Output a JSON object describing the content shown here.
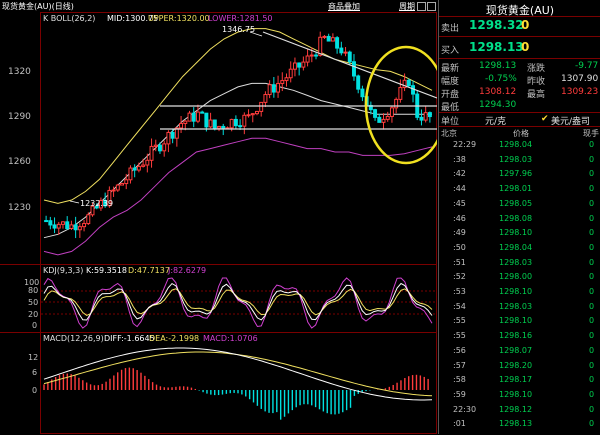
{
  "header": {
    "title": "现货黄金(AU)(日线)",
    "buttons": [
      "商品叠加",
      "周期"
    ],
    "extra_label": "周期"
  },
  "main_chart": {
    "label": "K  BOLL(26,2)",
    "mid": "MID:1300.75",
    "upper": "UPPER:1320.00",
    "lower": "LOWER:1281.50",
    "high_label": "1346.75",
    "low_label": "1232.39",
    "y_ticks": [
      "1320",
      "1290",
      "1260",
      "1230"
    ]
  },
  "kdj": {
    "label": "KDJ(9,3,3)",
    "k": "K:59.3518",
    "d": "D:47.7137",
    "j": "J:82.6279",
    "y_ticks": [
      "100",
      "80",
      "50",
      "20",
      "0"
    ]
  },
  "macd": {
    "label": "MACD(12,26,9)",
    "diff": "DIFF:-1.6645",
    "dea": "DEA:-2.1998",
    "macd": "MACD:1.0706",
    "y_ticks": [
      "12",
      "6",
      "0"
    ]
  },
  "quote": {
    "title": "现货黄金(AU)",
    "sell_label": "卖出",
    "sell_price": "1298.32",
    "sell_vol": "0",
    "buy_label": "买入",
    "buy_price": "1298.13",
    "buy_vol": "0",
    "rows": [
      {
        "l1": "最新",
        "v1": "1298.13",
        "l2": "涨跌",
        "v2": "-9.77"
      },
      {
        "l1": "幅度",
        "v1": "-0.75%",
        "l2": "昨收",
        "v2": "1307.90"
      },
      {
        "l1": "开盘",
        "v1": "1308.12",
        "l2": "最高",
        "v2": "1309.23"
      },
      {
        "l1": "最低",
        "v1": "1294.30",
        "l2": "",
        "v2": ""
      }
    ],
    "unit_label": "单位",
    "unit_value": "元/克",
    "currency": "美元/盎司",
    "col_time": "北京",
    "col_price": "价格",
    "col_vol": "现手"
  },
  "ticks": [
    {
      "t": "22:29",
      "p": "1298.04",
      "v": "0"
    },
    {
      "t": ":38",
      "p": "1298.03",
      "v": "0"
    },
    {
      "t": ":42",
      "p": "1297.96",
      "v": "0"
    },
    {
      "t": ":44",
      "p": "1298.01",
      "v": "0"
    },
    {
      "t": ":45",
      "p": "1298.05",
      "v": "0"
    },
    {
      "t": ":46",
      "p": "1298.08",
      "v": "0"
    },
    {
      "t": ":49",
      "p": "1298.10",
      "v": "0"
    },
    {
      "t": ":50",
      "p": "1298.04",
      "v": "0"
    },
    {
      "t": ":51",
      "p": "1298.03",
      "v": "0"
    },
    {
      "t": ":52",
      "p": "1298.00",
      "v": "0"
    },
    {
      "t": ":53",
      "p": "1298.10",
      "v": "0"
    },
    {
      "t": ":54",
      "p": "1298.03",
      "v": "0"
    },
    {
      "t": ":55",
      "p": "1298.10",
      "v": "0"
    },
    {
      "t": ":55",
      "p": "1298.16",
      "v": "0"
    },
    {
      "t": ":56",
      "p": "1298.07",
      "v": "0"
    },
    {
      "t": ":57",
      "p": "1298.20",
      "v": "0"
    },
    {
      "t": ":58",
      "p": "1298.17",
      "v": "0"
    },
    {
      "t": ":59",
      "p": "1298.10",
      "v": "0"
    },
    {
      "t": "22:30",
      "p": "1298.12",
      "v": "0"
    },
    {
      "t": ":01",
      "p": "1298.13",
      "v": "0"
    }
  ],
  "colors": {
    "up": "#ff3c3c",
    "down": "#00e0e0",
    "upper_band": "#f0e060",
    "lower_band": "#c040c0",
    "mid_band": "#ffffff",
    "highlight_circle": "#f0e020",
    "kdj_k": "#ffffff",
    "kdj_d": "#f0e060",
    "kdj_j": "#d040d0"
  },
  "chart_data": {
    "type": "candlestick",
    "ylim": [
      1215,
      1355
    ],
    "upper_band": [
      1250,
      1248,
      1250,
      1255,
      1262,
      1272,
      1282,
      1292,
      1302,
      1312,
      1322,
      1330,
      1338,
      1344,
      1348,
      1350,
      1350,
      1348,
      1344,
      1340,
      1336,
      1332,
      1330,
      1328,
      1326,
      1325,
      1322,
      1318,
      1314
    ],
    "mid_band": [
      1228,
      1230,
      1234,
      1240,
      1248,
      1256,
      1264,
      1272,
      1280,
      1288,
      1296,
      1302,
      1308,
      1312,
      1316,
      1318,
      1318,
      1316,
      1314,
      1311,
      1308,
      1306,
      1304,
      1302,
      1300,
      1300,
      1300,
      1300,
      1300
    ],
    "lower_band": [
      1220,
      1218,
      1220,
      1226,
      1234,
      1240,
      1244,
      1250,
      1258,
      1266,
      1272,
      1278,
      1280,
      1282,
      1284,
      1286,
      1286,
      1284,
      1282,
      1280,
      1280,
      1278,
      1278,
      1276,
      1276,
      1276,
      1277,
      1279,
      1281
    ]
  }
}
